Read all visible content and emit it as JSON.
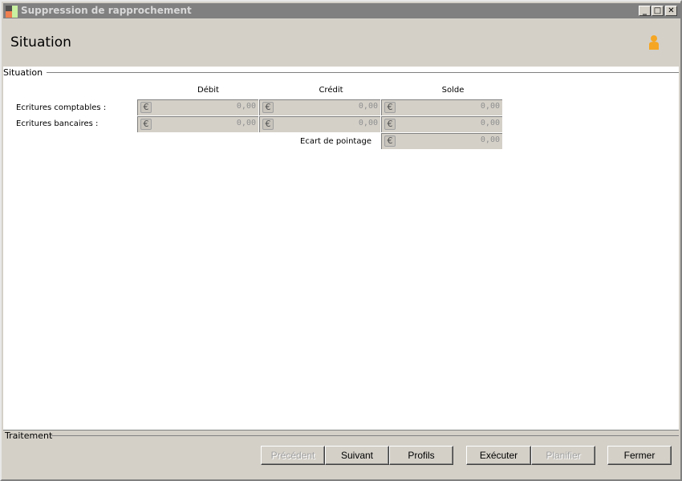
{
  "window": {
    "title": "Suppression de rapprochement",
    "controls": [
      "minimize",
      "maximize",
      "close"
    ]
  },
  "header": {
    "title": "Situation",
    "icon": "person-icon"
  },
  "situation": {
    "legend": "Situation",
    "columns": [
      "Débit",
      "Crédit",
      "Solde"
    ],
    "rows": [
      {
        "label": "Ecritures comptables :",
        "values": [
          "0,00",
          "0,00",
          "0,00"
        ]
      },
      {
        "label": "Ecritures  bancaires :",
        "values": [
          "0,00",
          "0,00",
          "0,00"
        ]
      }
    ],
    "ecart": {
      "label": "Ecart de pointage",
      "value": "0,00"
    },
    "currency_symbol": "€"
  },
  "traitement": {
    "legend": "Traitement"
  },
  "buttons": {
    "previous": "Précédent",
    "next": "Suivant",
    "profiles": "Profils",
    "execute": "Exécuter",
    "schedule": "Planifier",
    "close": "Fermer"
  }
}
